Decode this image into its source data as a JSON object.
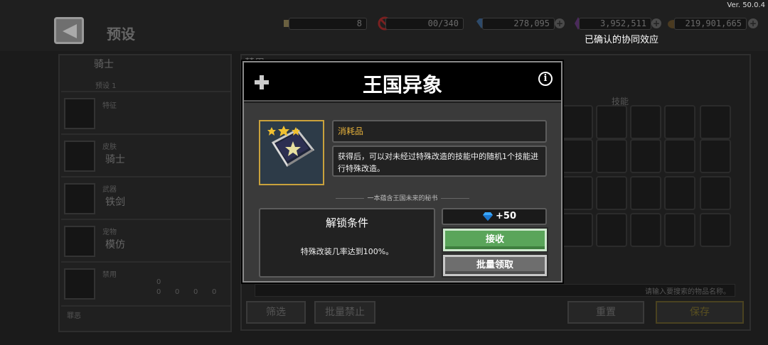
{
  "header": {
    "title": "预设",
    "version": "Ver. 50.0.4",
    "synergy_label": "已确认的协同效应"
  },
  "resources": [
    {
      "icon": "scroll-icon",
      "value": "8"
    },
    {
      "icon": "ban-icon",
      "value": "00/340"
    },
    {
      "icon": "gem-icon",
      "value": "278,095"
    },
    {
      "icon": "crystal-icon",
      "value": "3,952,511"
    },
    {
      "icon": "coin-icon",
      "value": "219,901,665"
    }
  ],
  "left_panel": {
    "character": "骑士",
    "preset": "预设 1",
    "trait_label": "特征",
    "skin_label": "皮肤",
    "skin_value": "骑士",
    "weapon_label": "武器",
    "weapon_value": "铁剑",
    "pet_label": "宠物",
    "pet_value": "模仿",
    "ban_label": "禁用",
    "ban_count": "0",
    "ban_counts": [
      "0",
      "0",
      "0",
      "0",
      "0"
    ],
    "curse_label": "罪恶"
  },
  "right_panel": {
    "tab_label": "禁用",
    "skill_tab": "技能",
    "search_placeholder": "请输入要搜索的物品名称。",
    "filter_button": "筛选",
    "bulk_ban_button": "批量禁止",
    "reset_button": "重置",
    "save_button": "保存"
  },
  "modal": {
    "title": "王国异象",
    "item_type": "消耗品",
    "description": "获得后，可以对未经过特殊改造的技能中的随机1个技能进行特殊改造。",
    "flavor_text": "一本蕴含王国未来的秘书",
    "item_stars": 3,
    "unlock_title": "解锁条件",
    "unlock_condition": "特殊改装几率达到100%。",
    "reward": "+50",
    "accept_button": "接收",
    "bulk_claim_button": "批量领取"
  },
  "colors": {
    "accept": "#5aa55a",
    "item_type_text": "#e8b33c",
    "item_frame": "#c9a13c"
  }
}
